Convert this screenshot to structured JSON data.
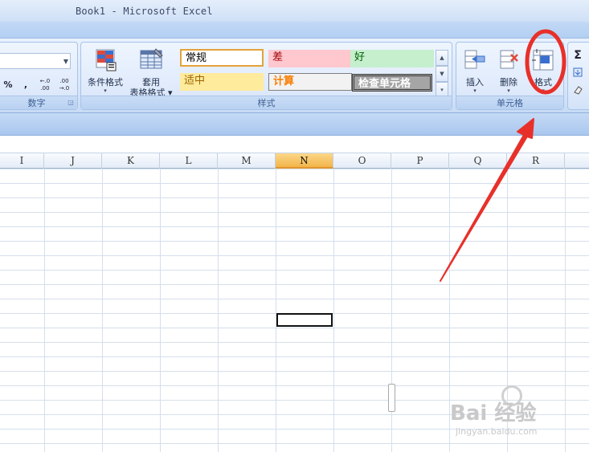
{
  "window": {
    "title": "Book1 - Microsoft Excel"
  },
  "number_group": {
    "label": "数字",
    "percent": "%",
    "comma": ",",
    "increase_decimal": "←.0 .00",
    "decrease_decimal": ".00 →.0"
  },
  "styles_group": {
    "label": "样式",
    "conditional_formatting": "条件格式",
    "format_as_table_1": "套用",
    "format_as_table_2": "表格格式",
    "styles": [
      {
        "name": "常规",
        "bg": "#ffffff",
        "fg": "#000000",
        "border": "#e3a33b"
      },
      {
        "name": "差",
        "bg": "#ffc7ce",
        "fg": "#9c0006",
        "border": "#ffc7ce"
      },
      {
        "name": "好",
        "bg": "#c6efce",
        "fg": "#006100",
        "border": "#c6efce"
      },
      {
        "name": "适中",
        "bg": "#ffeb9c",
        "fg": "#9c6500",
        "border": "#ffeb9c"
      },
      {
        "name": "计算",
        "bg": "#f2f2f2",
        "fg": "#fa7d00",
        "border": "#7f7f7f"
      },
      {
        "name": "检查单元格",
        "bg": "#a5a5a5",
        "fg": "#ffffff",
        "border": "#3f3f3f"
      }
    ]
  },
  "cells_group": {
    "label": "单元格",
    "insert": "插入",
    "delete": "删除",
    "format": "格式"
  },
  "editing_group": {
    "sum_symbol": "Σ"
  },
  "columns": [
    "I",
    "J",
    "K",
    "L",
    "M",
    "N",
    "O",
    "P",
    "Q",
    "R"
  ],
  "selected_column": "N",
  "watermark": {
    "brand": "Bai 经验",
    "url": "jingyan.baidu.com"
  },
  "colors": {
    "annotation": "#e8302a",
    "selected_header": "#f2b44b"
  }
}
